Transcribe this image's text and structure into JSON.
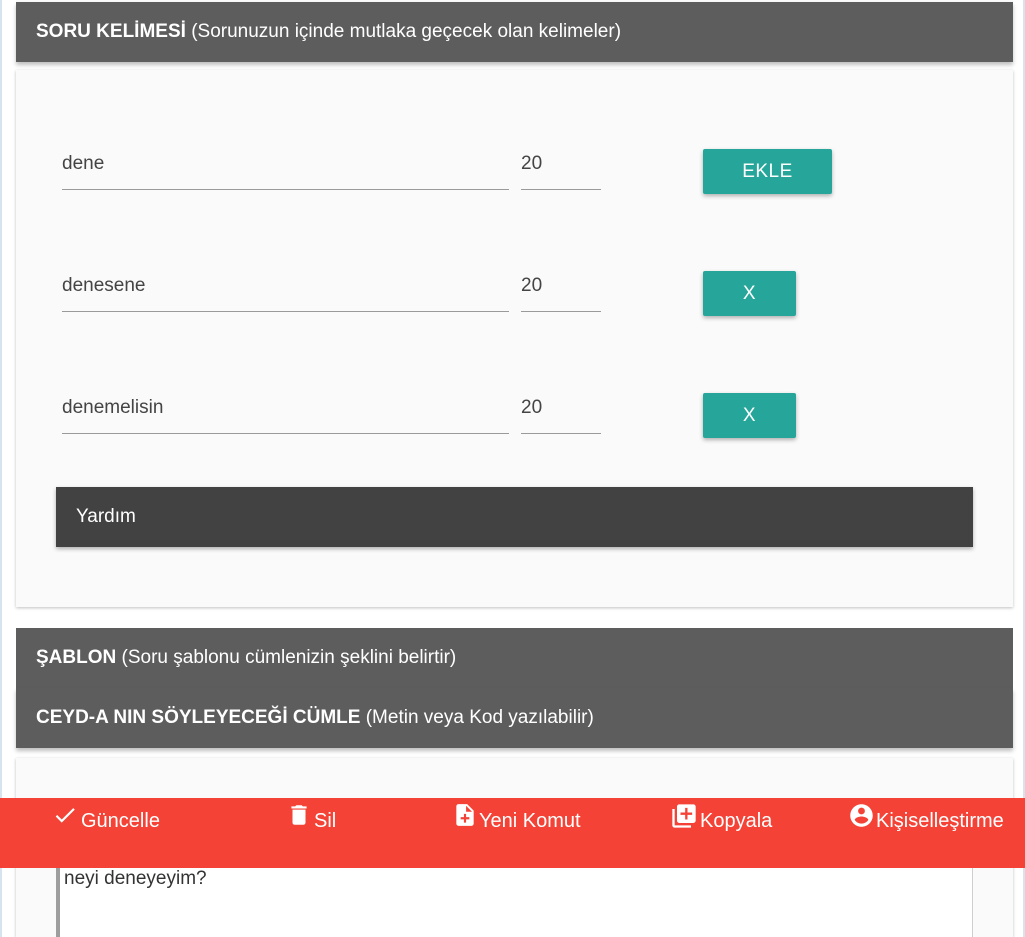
{
  "soru_kelimesi": {
    "title": "SORU KELİMESİ",
    "subtitle": "(Sorunuzun içinde mutlaka geçecek olan kelimeler)",
    "rows": [
      {
        "word": "dene",
        "weight": "20",
        "button": "EKLE"
      },
      {
        "word": "denesene",
        "weight": "20",
        "button": "X"
      },
      {
        "word": "denemelisin",
        "weight": "20",
        "button": "X"
      }
    ],
    "help_label": "Yardım"
  },
  "sablon": {
    "title": "ŞABLON",
    "subtitle": "(Soru şablonu cümlenizin şeklini belirtir)"
  },
  "ceyda": {
    "title": "CEYD-A NIN SÖYLEYECEĞİ CÜMLE",
    "subtitle": "(Metin veya Kod yazılabilir)",
    "text_value": "neyi deneyeyim?"
  },
  "toolbar": {
    "items": [
      {
        "label": "Güncelle",
        "icon": "check-icon"
      },
      {
        "label": "Sil",
        "icon": "trash-icon"
      },
      {
        "label": "Yeni Komut",
        "icon": "new-document-icon"
      },
      {
        "label": "Kopyala",
        "icon": "copy-icon"
      },
      {
        "label": "Kişiselleştirme",
        "icon": "account-circle-icon"
      }
    ]
  },
  "colors": {
    "header_bg": "#5d5d5d",
    "help_bg": "#424242",
    "button_teal": "#26a69a",
    "toolbar_red": "#f44336",
    "card_bg": "#fafafa"
  }
}
